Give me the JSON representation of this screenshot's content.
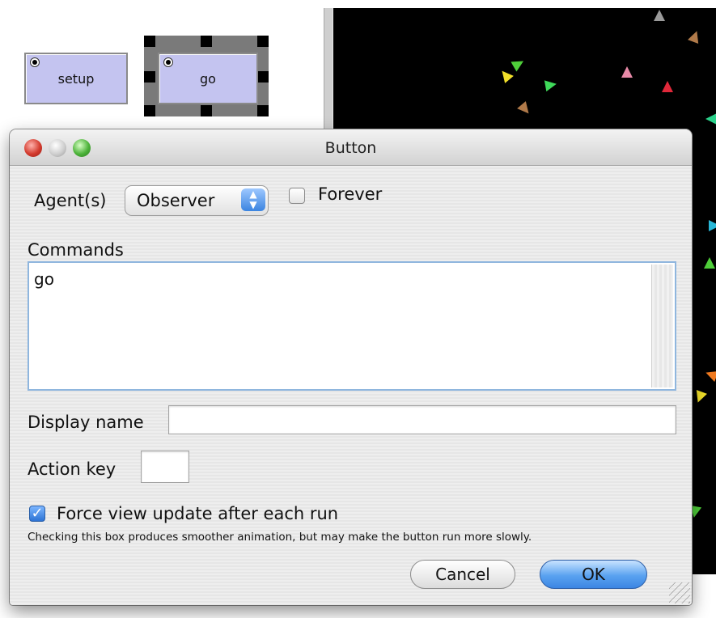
{
  "workspace": {
    "buttons": [
      {
        "label": "setup"
      },
      {
        "label": "go"
      }
    ]
  },
  "dialog": {
    "title": "Button",
    "agents_label": "Agent(s)",
    "agents_value": "Observer",
    "forever_label": "Forever",
    "forever_checked": false,
    "commands_label": "Commands",
    "commands_value": "go",
    "display_name_label": "Display name",
    "display_name_value": "",
    "action_key_label": "Action key",
    "action_key_value": "",
    "force_update_label": "Force view update after each run",
    "force_update_checked": true,
    "hint": "Checking this box produces smoother animation, but may make the button run more slowly.",
    "cancel_label": "Cancel",
    "ok_label": "OK"
  },
  "icons": {
    "select_arrows": "up-down-arrows-icon",
    "checkmark": "checkmark-icon"
  }
}
